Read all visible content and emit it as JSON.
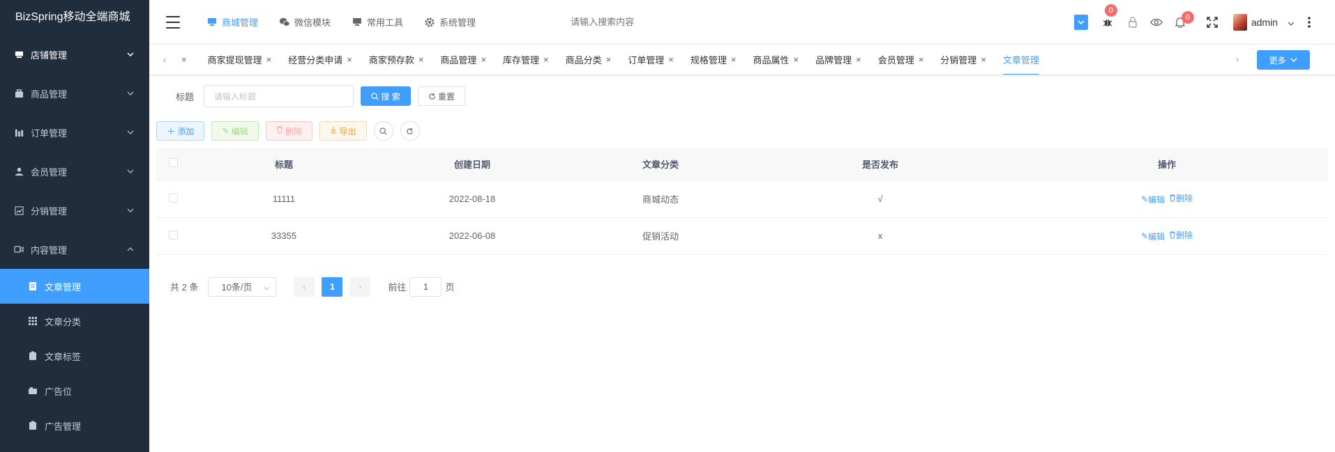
{
  "brand": {
    "title": "BizSpring移动全端商城"
  },
  "sidebar": {
    "groups": [
      {
        "label": "店铺管理",
        "icon": "shop-icon"
      },
      {
        "label": "商品管理",
        "icon": "goods-icon"
      },
      {
        "label": "订单管理",
        "icon": "order-icon"
      },
      {
        "label": "会员管理",
        "icon": "user-icon"
      },
      {
        "label": "分销管理",
        "icon": "chart-icon"
      },
      {
        "label": "内容管理",
        "icon": "video-icon"
      }
    ],
    "sub_items": [
      {
        "label": "文章管理",
        "icon": "article-icon",
        "active": true
      },
      {
        "label": "文章分类",
        "icon": "grid-icon",
        "active": false
      },
      {
        "label": "文章标签",
        "icon": "clipboard-icon",
        "active": false
      },
      {
        "label": "广告位",
        "icon": "camera-icon",
        "active": false
      },
      {
        "label": "广告管理",
        "icon": "clipboard-icon",
        "active": false
      }
    ]
  },
  "topnav": {
    "items": [
      {
        "label": "商城管理",
        "icon": "monitor-icon",
        "active": true
      },
      {
        "label": "微信模块",
        "icon": "wechat-icon",
        "active": false
      },
      {
        "label": "常用工具",
        "icon": "desktop-icon",
        "active": false
      },
      {
        "label": "系统管理",
        "icon": "gear-icon",
        "active": false
      }
    ],
    "search_placeholder": "请输入搜索内容",
    "bug_badge": "0",
    "notify_badge": "0",
    "username": "admin"
  },
  "tags": {
    "items": [
      {
        "label": "商家提现管理",
        "active": false
      },
      {
        "label": "经营分类申请",
        "active": false
      },
      {
        "label": "商家预存款",
        "active": false
      },
      {
        "label": "商品管理",
        "active": false
      },
      {
        "label": "库存管理",
        "active": false
      },
      {
        "label": "商品分类",
        "active": false
      },
      {
        "label": "订单管理",
        "active": false
      },
      {
        "label": "规格管理",
        "active": false
      },
      {
        "label": "商品属性",
        "active": false
      },
      {
        "label": "品牌管理",
        "active": false
      },
      {
        "label": "会员管理",
        "active": false
      },
      {
        "label": "分销管理",
        "active": false
      },
      {
        "label": "文章管理",
        "active": true
      }
    ],
    "more_label": "更多"
  },
  "search_form": {
    "title_label": "标题",
    "title_placeholder": "请输入标题",
    "search_label": "搜 索",
    "reset_label": "重置"
  },
  "toolbar": {
    "add_label": "添加",
    "edit_label": "编辑",
    "delete_label": "删除",
    "export_label": "导出"
  },
  "table": {
    "columns": [
      "标题",
      "创建日期",
      "文章分类",
      "是否发布",
      "操作"
    ],
    "rows": [
      {
        "title": "11111",
        "date": "2022-08-18",
        "category": "商城动态",
        "published": "√"
      },
      {
        "title": "33355",
        "date": "2022-06-08",
        "category": "促销活动",
        "published": "x"
      }
    ],
    "edit_label": "编辑",
    "delete_label": "删除"
  },
  "pagination": {
    "total_text": "共 2 条",
    "page_size": "10条/页",
    "current_page": "1",
    "goto_label": "前往",
    "goto_value": "1",
    "page_suffix": "页"
  },
  "colors": {
    "primary": "#409eff",
    "sidebar_bg": "#1f2d3d",
    "danger": "#f56c6c"
  }
}
